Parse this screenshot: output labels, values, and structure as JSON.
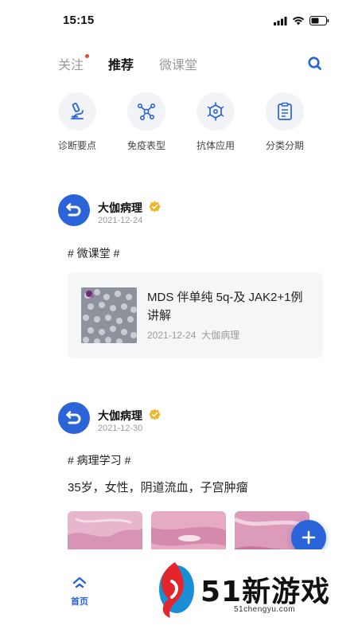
{
  "status": {
    "time": "15:15"
  },
  "tabs": [
    {
      "label": "关注",
      "active": false,
      "has_dot": true
    },
    {
      "label": "推荐",
      "active": true,
      "has_dot": false
    },
    {
      "label": "微课堂",
      "active": false,
      "has_dot": false
    }
  ],
  "quick_links": [
    {
      "label": "诊断要点",
      "icon": "microscope-icon"
    },
    {
      "label": "免疫表型",
      "icon": "molecule-icon"
    },
    {
      "label": "抗体应用",
      "icon": "antibody-icon"
    },
    {
      "label": "分类分期",
      "icon": "clipboard-icon"
    }
  ],
  "posts": [
    {
      "author": "大伽病理",
      "date": "2021-12-24",
      "hashtag": "# 微课堂 #",
      "course": {
        "title": "MDS 伴单纯 5q-及 JAK2+1例讲解",
        "date": "2021-12-24",
        "source": "大伽病理"
      }
    },
    {
      "author": "大伽病理",
      "date": "2021-12-30",
      "hashtag": "# 病理学习 #",
      "title": "35岁，女性，阴道流血，子宫肿瘤"
    }
  ],
  "bottom_nav": {
    "home_label": "首页"
  },
  "watermark": {
    "brand": "51新游戏",
    "url": "51chengyu.com"
  },
  "colors": {
    "accent": "#2b63d9",
    "badge": "#f0b429",
    "dot": "#e8463b"
  }
}
